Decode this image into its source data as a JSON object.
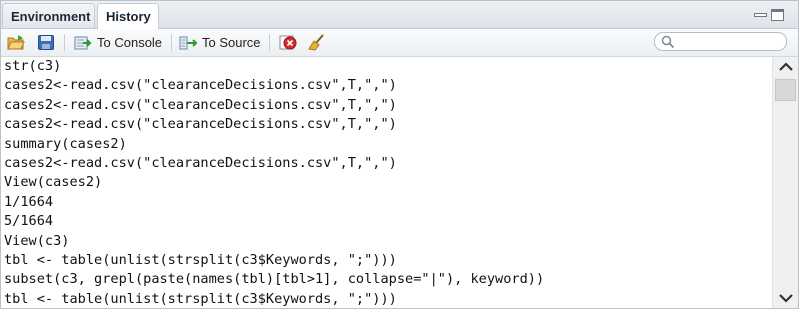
{
  "tabs": [
    {
      "label": "Environment"
    },
    {
      "label": "History"
    }
  ],
  "toolbar": {
    "to_console_label": "To Console",
    "to_source_label": "To Source",
    "search_placeholder": ""
  },
  "history": [
    "str(c3)",
    "cases2<-read.csv(\"clearanceDecisions.csv\",T,\",\")",
    "cases2<-read.csv(\"clearanceDecisions.csv\",T,\",\")",
    "cases2<-read.csv(\"clearanceDecisions.csv\",T,\",\")",
    "summary(cases2)",
    "cases2<-read.csv(\"clearanceDecisions.csv\",T,\",\")",
    "View(cases2)",
    "1/1664",
    "5/1664",
    "View(c3)",
    "tbl <- table(unlist(strsplit(c3$Keywords, \";\")))",
    "subset(c3, grepl(paste(names(tbl)[tbl>1], collapse=\"|\"), keyword))",
    "tbl <- table(unlist(strsplit(c3$Keywords, \";\")))"
  ],
  "colors": {
    "tab_bg": "#dde3e9",
    "border": "#b9c3cd",
    "text": "#111111"
  },
  "icons": [
    "load-history-icon",
    "save-history-icon",
    "to-console-icon",
    "to-source-icon",
    "remove-entry-icon",
    "clear-all-icon",
    "search-icon",
    "minimize-icon",
    "maximize-icon",
    "scroll-up-icon",
    "scroll-down-icon"
  ]
}
